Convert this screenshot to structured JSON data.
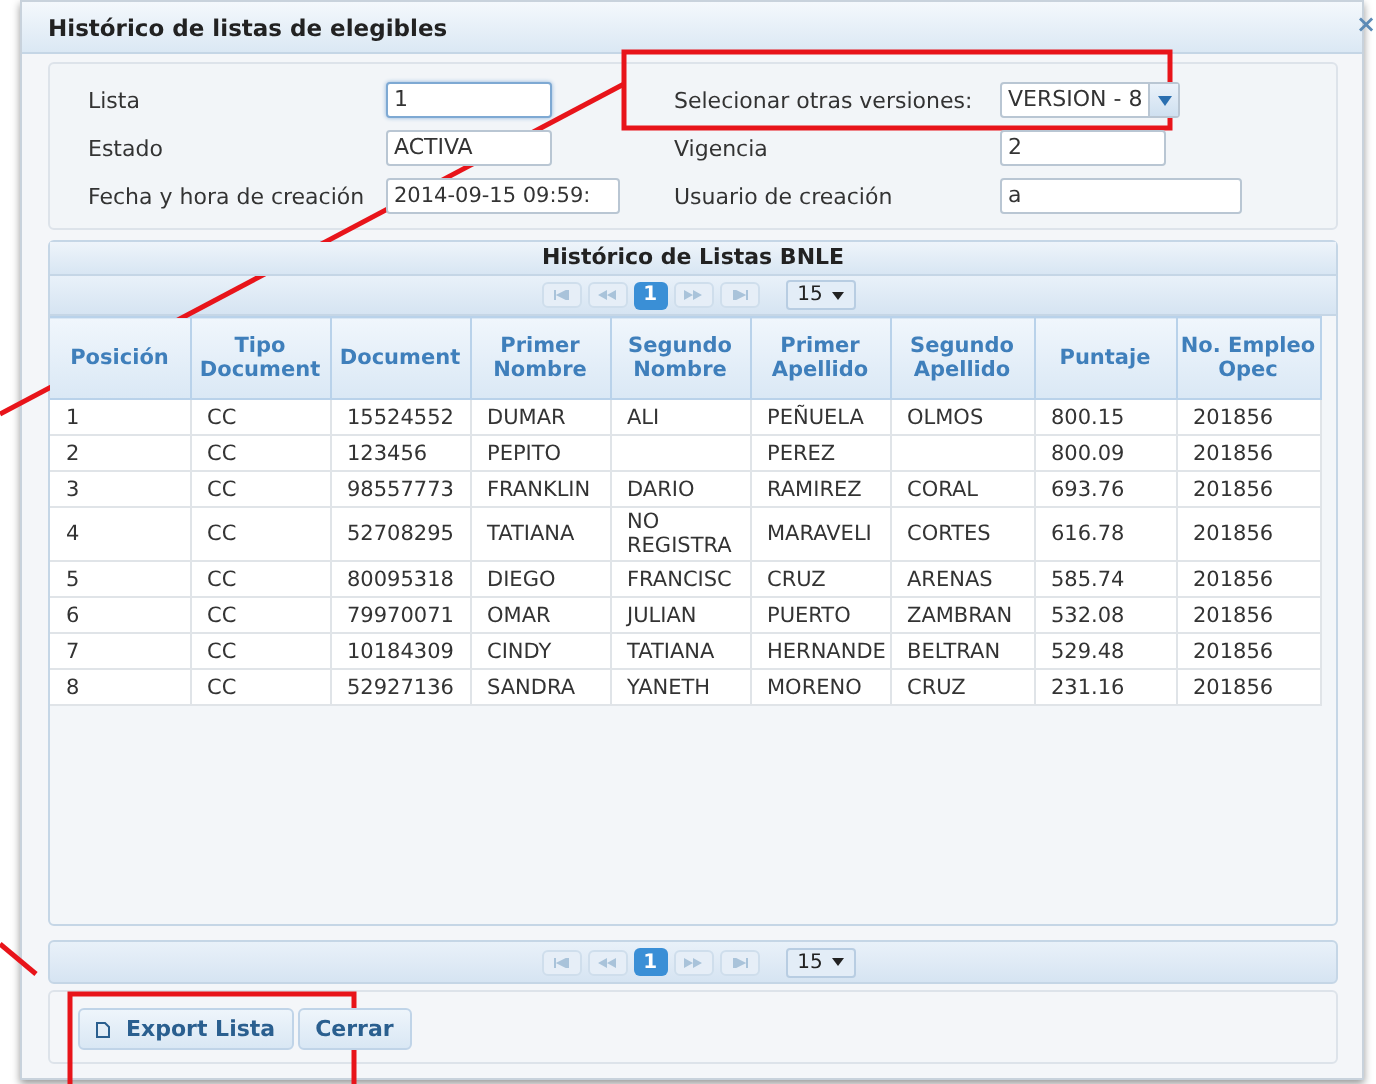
{
  "window": {
    "title": "Histórico de listas de elegibles",
    "close": "×"
  },
  "form": {
    "left": [
      {
        "label": "Lista",
        "value": "1",
        "focused": true
      },
      {
        "label": "Estado",
        "value": "ACTIVA",
        "focused": false
      },
      {
        "label": "Fecha y hora de creación",
        "value": "2014-09-15 09:59:",
        "focused": false
      }
    ],
    "right": [
      {
        "label": "Selecionar otras versiones:",
        "value": "VERSION - 8",
        "kind": "select"
      },
      {
        "label": "Vigencia",
        "value": "2",
        "kind": "input"
      },
      {
        "label": "Usuario de creación",
        "value": "a",
        "kind": "input"
      }
    ]
  },
  "table": {
    "title": "Histórico de Listas BNLE",
    "pager_top": {
      "pages": [
        {
          "label": "1",
          "selected": true
        }
      ],
      "page_size": "15"
    },
    "columns": [
      "Posición",
      "Tipo Document",
      "Document",
      "Primer Nombre",
      "Segundo Nombre",
      "Primer Apellido",
      "Segundo Apellido",
      "Puntaje",
      "No. Empleo Opec"
    ],
    "rows": [
      [
        "1",
        "CC",
        "15524552",
        "DUMAR",
        "ALI",
        "PEÑUELA",
        "OLMOS",
        "800.15",
        "201856"
      ],
      [
        "2",
        "CC",
        "123456",
        "PEPITO",
        "",
        "PEREZ",
        "",
        "800.09",
        "201856"
      ],
      [
        "3",
        "CC",
        "98557773",
        "FRANKLIN",
        "DARIO",
        "RAMIREZ",
        "CORAL",
        "693.76",
        "201856"
      ],
      [
        "4",
        "CC",
        "52708295",
        "TATIANA",
        "NO REGISTRA",
        "MARAVELI",
        "CORTES",
        "616.78",
        "201856"
      ],
      [
        "5",
        "CC",
        "80095318",
        "DIEGO",
        "FRANCISC",
        "CRUZ",
        "ARENAS",
        "585.74",
        "201856"
      ],
      [
        "6",
        "CC",
        "79970071",
        "OMAR",
        "JULIAN",
        "PUERTO",
        "ZAMBRAN",
        "532.08",
        "201856"
      ],
      [
        "7",
        "CC",
        "10184309",
        "CINDY",
        "TATIANA",
        "HERNANDE",
        "BELTRAN",
        "529.48",
        "201856"
      ],
      [
        "8",
        "CC",
        "52927136",
        "SANDRA",
        "YANETH",
        "MORENO",
        "CRUZ",
        "231.16",
        "201856"
      ]
    ],
    "pager_bottom": {
      "pages": [
        {
          "label": "1",
          "selected": true
        }
      ],
      "page_size": "15"
    }
  },
  "buttons": [
    {
      "label": "Export Lista",
      "kind": "export"
    },
    {
      "label": "Cerrar",
      "kind": "plain"
    }
  ]
}
